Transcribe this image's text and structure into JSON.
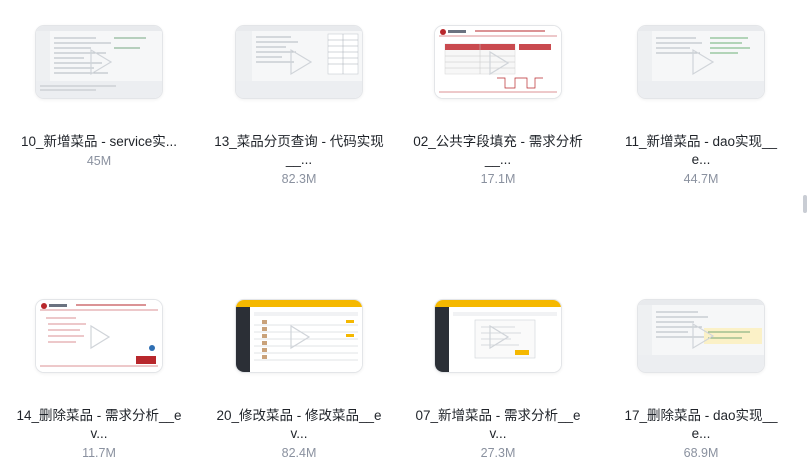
{
  "files": [
    {
      "title": "10_新增菜品 - service实...",
      "size": "45M",
      "thumb": "ide-light"
    },
    {
      "title": "13_菜品分页查询 - 代码实现__...",
      "size": "82.3M",
      "thumb": "ide-table"
    },
    {
      "title": "02_公共字段填充 - 需求分析__...",
      "size": "17.1M",
      "thumb": "slide-table"
    },
    {
      "title": "11_新增菜品 - dao实现__e...",
      "size": "44.7M",
      "thumb": "ide-green"
    },
    {
      "title": "14_删除菜品 - 需求分析__ev...",
      "size": "11.7M",
      "thumb": "slide-text"
    },
    {
      "title": "20_修改菜品 - 修改菜品__ev...",
      "size": "82.4M",
      "thumb": "admin-list"
    },
    {
      "title": "07_新增菜品 - 需求分析__ev...",
      "size": "27.3M",
      "thumb": "admin-dialog"
    },
    {
      "title": "17_删除菜品 - dao实现__e...",
      "size": "68.9M",
      "thumb": "ide-yellow"
    }
  ],
  "colors": {
    "text": "#1f2329",
    "muted": "#8a919f",
    "accent_red": "#b8272c",
    "accent_yellow": "#f5b800"
  }
}
